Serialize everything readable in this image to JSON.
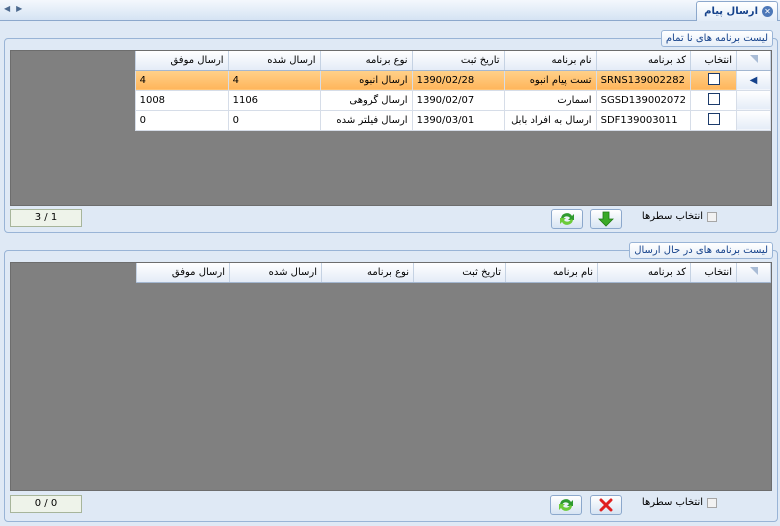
{
  "window": {
    "title": "ارسال پیام"
  },
  "panel_pending": {
    "title": "لیست برنامه های نا تمام",
    "columns": [
      "انتخاب",
      "کد برنامه",
      "نام برنامه",
      "تاریخ ثبت",
      "نوع برنامه",
      "ارسال شده",
      "ارسال موفق"
    ],
    "rows": [
      {
        "code": "SRNS139002282",
        "name": "تست پیام انبوه",
        "date": "1390/02/28",
        "type": "ارسال انبوه",
        "sent": "4",
        "success": "4"
      },
      {
        "code": "SGSD139002072",
        "name": "اسمارت",
        "date": "1390/02/07",
        "type": "ارسال گروهی",
        "sent": "1106",
        "success": "1008"
      },
      {
        "code": "SDF139003011",
        "name": "ارسال به افراد بابل",
        "date": "1390/03/01",
        "type": "ارسال فیلتر شده",
        "sent": "0",
        "success": "0"
      }
    ],
    "select_rows_label": "انتخاب سطرها",
    "pager": "3 / 1"
  },
  "panel_sending": {
    "title": "لیست برنامه های در حال ارسال",
    "columns": [
      "انتخاب",
      "کد برنامه",
      "نام برنامه",
      "تاریخ ثبت",
      "نوع برنامه",
      "ارسال شده",
      "ارسال موفق"
    ],
    "select_rows_label": "انتخاب سطرها",
    "pager": "0 / 0"
  },
  "colors": {
    "selected_row": "#ffc070",
    "grid_background": "#808080",
    "accent": "#15428b"
  }
}
